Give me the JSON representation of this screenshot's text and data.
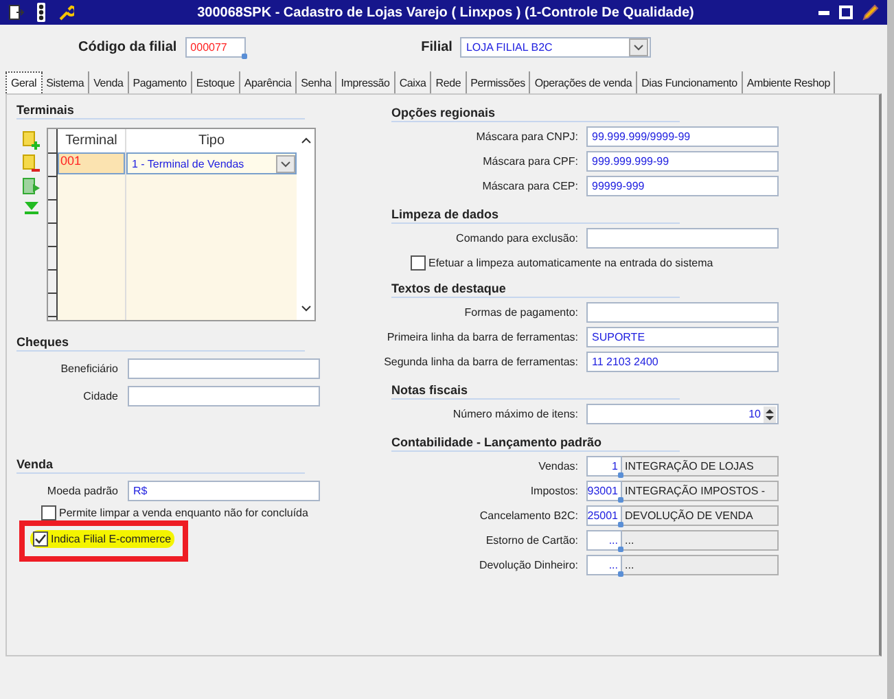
{
  "window": {
    "title": "300068SPK - Cadastro de Lojas Varejo ( Linxpos ) (1-Controle De Qualidade)"
  },
  "header": {
    "code_label": "Código da filial",
    "code": "000077",
    "branch_label": "Filial",
    "branch": "LOJA FILIAL B2C"
  },
  "tabs": [
    {
      "label": "Geral",
      "selected": true
    },
    {
      "label": "Sistema",
      "selected": false
    },
    {
      "label": "Venda",
      "selected": false
    },
    {
      "label": "Pagamento",
      "selected": false
    },
    {
      "label": "Estoque",
      "selected": false
    },
    {
      "label": "Aparência",
      "selected": false
    },
    {
      "label": "Senha",
      "selected": false
    },
    {
      "label": "Impressão",
      "selected": false
    },
    {
      "label": "Caixa",
      "selected": false
    },
    {
      "label": "Rede",
      "selected": false
    },
    {
      "label": "Permissões",
      "selected": false
    },
    {
      "label": "Operações de venda",
      "selected": false
    },
    {
      "label": "Dias Funcionamento",
      "selected": false
    },
    {
      "label": "Ambiente Reshop",
      "selected": false
    }
  ],
  "terminals": {
    "title": "Terminais",
    "columns": [
      "Terminal",
      "Tipo"
    ],
    "rows": [
      {
        "terminal": "001",
        "type": "1 - Terminal de Vendas",
        "selected": true
      }
    ]
  },
  "cheques": {
    "title": "Cheques",
    "fields": [
      {
        "label": "Beneficiário"
      },
      {
        "label": "Cidade"
      }
    ]
  },
  "venda": {
    "title": "Venda",
    "fields": [
      {
        "label": "Moeda padrão",
        "value": "R$"
      }
    ],
    "checkboxes": [
      {
        "label": "Permite limpar a venda enquanto não for concluída",
        "checked": false,
        "highlighted": false
      },
      {
        "label": "Indica Filial E-commerce",
        "checked": true,
        "highlighted": true
      }
    ]
  },
  "sections": [
    {
      "title": "Opções regionais",
      "rows": [
        {
          "kind": "field",
          "label": "Máscara para CNPJ:",
          "value": "99.999.999/9999-99"
        },
        {
          "kind": "field",
          "label": "Máscara para CPF:",
          "value": "999.999.999-99"
        },
        {
          "kind": "field",
          "label": "Máscara para CEP:",
          "value": "99999-999"
        }
      ]
    },
    {
      "title": "Limpeza de dados",
      "rows": [
        {
          "kind": "field",
          "label": "Comando para exclusão:"
        },
        {
          "kind": "checkbox",
          "label": "Efetuar a limpeza automaticamente na entrada do sistema",
          "checked": false
        }
      ]
    },
    {
      "title": "Textos de destaque",
      "rows": [
        {
          "kind": "field",
          "label": "Formas de pagamento:"
        },
        {
          "kind": "field",
          "label": "Primeira linha da barra de ferramentas:",
          "value": "SUPORTE"
        },
        {
          "kind": "field",
          "label": "Segunda linha da barra de ferramentas:",
          "value": "11 2103 2400"
        }
      ]
    },
    {
      "title": "Notas fiscais",
      "rows": [
        {
          "kind": "spin",
          "label": "Número máximo de itens:",
          "value": "10"
        }
      ]
    },
    {
      "title": "Contabilidade - Lançamento padrão",
      "rows": [
        {
          "kind": "lookup",
          "label": "Vendas:",
          "code": "1",
          "description": "INTEGRAÇÃO DE LOJAS"
        },
        {
          "kind": "lookup",
          "label": "Impostos:",
          "code": "93001",
          "description": "INTEGRAÇÃO IMPOSTOS -"
        },
        {
          "kind": "lookup",
          "label": "Cancelamento B2C:",
          "code": "25001",
          "description": "DEVOLUÇÃO DE VENDA"
        },
        {
          "kind": "lookup",
          "label": "Estorno de Cartão:",
          "code": "...",
          "description": "..."
        },
        {
          "kind": "lookup",
          "label": "Devolução Dinheiro:",
          "code": "...",
          "description": "..."
        }
      ]
    }
  ]
}
